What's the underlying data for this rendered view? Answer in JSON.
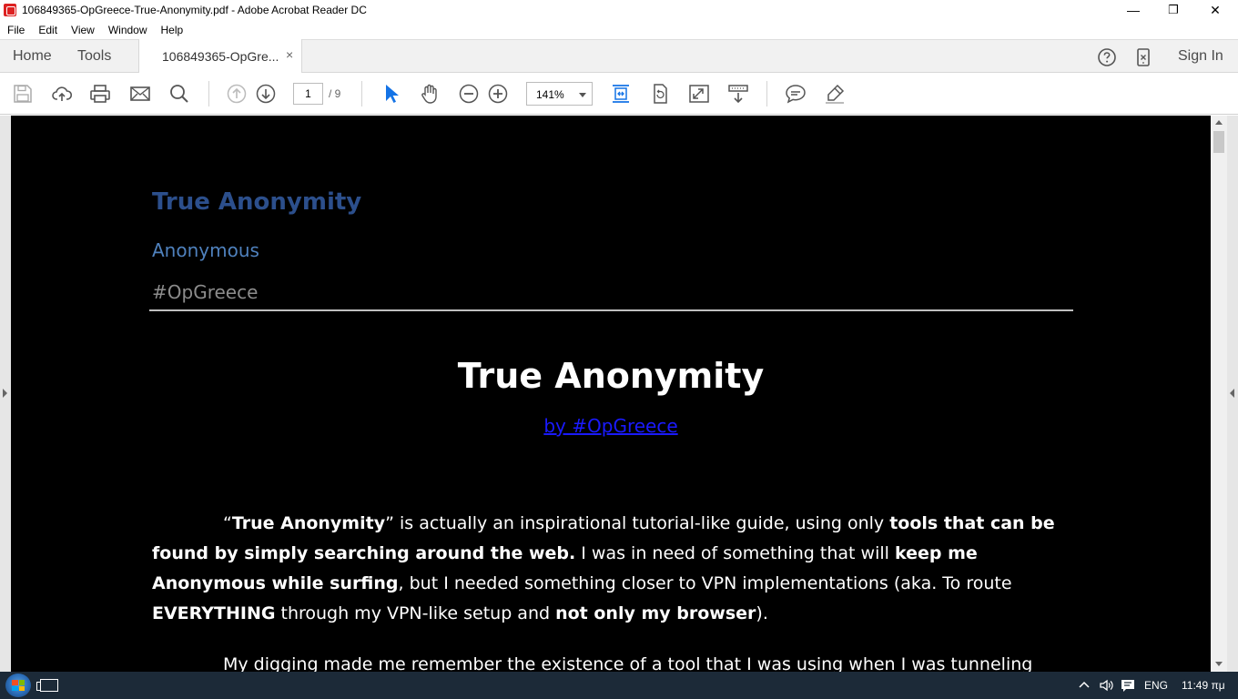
{
  "window": {
    "title": "106849365-OpGreece-True-Anonymity.pdf - Adobe Acrobat Reader DC",
    "minimize_glyph": "—",
    "maximize_glyph": "❐",
    "close_glyph": "✕"
  },
  "menu": [
    "File",
    "Edit",
    "View",
    "Window",
    "Help"
  ],
  "tabs": {
    "home": "Home",
    "tools": "Tools",
    "document": "106849365-OpGre...",
    "close_glyph": "×",
    "sign_in": "Sign In"
  },
  "toolbar": {
    "page_current": "1",
    "page_total": "/ 9",
    "zoom": "141%",
    "icons": [
      "save-icon",
      "upload-cloud-icon",
      "print-icon",
      "email-icon",
      "search-icon",
      "previous-page-icon",
      "next-page-icon",
      "select-cursor-icon",
      "hand-icon",
      "zoom-out-icon",
      "zoom-in-icon",
      "fit-page-icon",
      "rotate-icon",
      "full-screen-icon",
      "scrolling-mode-icon",
      "comment-icon",
      "highlight-icon"
    ]
  },
  "document": {
    "title": "True Anonymity",
    "subtitle": "Anonymous",
    "tag": "#OpGreece",
    "heading": "True Anonymity",
    "byline": "by #OpGreece",
    "para1": {
      "q1": "“",
      "b1": "True Anonymity",
      "t1": "” is actually an inspirational tutorial-like guide, using only ",
      "b2": "tools that can be found by simply searching around the web.",
      "t2": " I was in need of something that will ",
      "b3": "keep me Anonymous while surfing",
      "t3": ", but I needed something closer to VPN implementations (aka. To route ",
      "b4": "EVERYTHING",
      "t4": " through my VPN-like setup and ",
      "b5": "not only my browser",
      "t5": ")."
    },
    "para2": "My digging made me remember the existence of a tool that I was using when I was tunneling"
  },
  "colors": {
    "title_blue": "#2c4f8c",
    "subtitle_blue": "#4f81bd",
    "tag_gray": "#8c8c8c",
    "link_blue": "#1a1aff",
    "page_bg": "#000000",
    "taskbar": "#1c2a38"
  },
  "taskbar": {
    "language": "ENG",
    "time": "11:49 πμ"
  }
}
